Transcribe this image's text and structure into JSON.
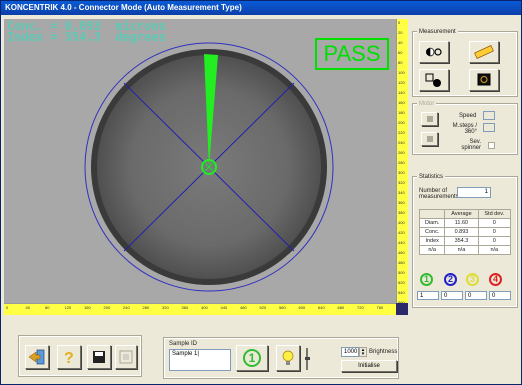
{
  "window": {
    "title": "KONCENTRIK 4.0 - Connector Mode (Auto Measurement Type)"
  },
  "overlay": {
    "conc_line": "Conc. = 0.893  microns",
    "index_line": "Index = 354.3  degrees",
    "result": "PASS"
  },
  "rulers": {
    "bottom_ticks": [
      "0",
      "40",
      "80",
      "120",
      "160",
      "200",
      "240",
      "280",
      "320",
      "360",
      "400",
      "440",
      "480",
      "520",
      "560",
      "600",
      "640",
      "680",
      "720",
      "760"
    ],
    "right_ticks": [
      "0",
      "20",
      "40",
      "60",
      "80",
      "100",
      "120",
      "140",
      "160",
      "180",
      "200",
      "220",
      "240",
      "260",
      "280",
      "300",
      "320",
      "340",
      "360",
      "380",
      "400",
      "420",
      "440",
      "460",
      "480",
      "500",
      "520",
      "540",
      "560"
    ]
  },
  "measurement": {
    "title": "Measurement"
  },
  "motor": {
    "title": "Motor",
    "speed_label": "Speed",
    "speed_value": "",
    "m_steps_label": "M.steps / 360°",
    "m_steps_value": "",
    "sev_label": "Sev. spinner"
  },
  "statistics": {
    "title": "Statistics",
    "count_label": "Number of measurements",
    "count_value": "1",
    "headers": [
      "",
      "Average",
      "Std dev."
    ],
    "rows": [
      [
        "Diam.",
        "11.60",
        "0"
      ],
      [
        "Conc.",
        "0.893",
        "0"
      ],
      [
        "Index",
        "354.3",
        "0"
      ],
      [
        "n/a",
        "n/a",
        "n/a"
      ]
    ],
    "counters": [
      {
        "label": "1",
        "color": "#33bb33",
        "value": "1"
      },
      {
        "label": "2",
        "color": "#2222cc",
        "value": "0"
      },
      {
        "label": "3",
        "color": "#dddd33",
        "value": "0"
      },
      {
        "label": "4",
        "color": "#dd2222",
        "value": "0"
      }
    ]
  },
  "sample": {
    "title": "Sample ID",
    "value": "Sample 1|",
    "indicator": "1"
  },
  "brightness": {
    "value": "1000",
    "label": "Brightness",
    "init_label": "Initialise"
  },
  "toolbar": {
    "icons": [
      "exit-icon",
      "help-icon",
      "save-icon",
      "print-icon"
    ]
  }
}
